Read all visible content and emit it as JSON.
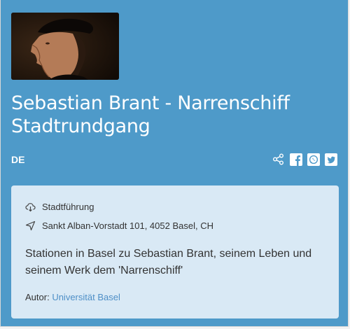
{
  "tour": {
    "title": "Sebastian Brant - Narrenschiff Stadtrundgang",
    "language": "DE"
  },
  "share": {
    "icons": [
      "share-icon",
      "facebook-icon",
      "whatsapp-icon",
      "twitter-icon"
    ]
  },
  "info": {
    "category": "Stadtführung",
    "address": "Sankt Alban-Vorstadt 101, 4052 Basel, CH",
    "description": "Stationen in Basel zu Sebastian Brant, seinem Leben und seinem Werk dem 'Narrenschiff'",
    "author_label": "Autor:",
    "author_name": "Universität Basel"
  },
  "colors": {
    "header_bg": "#4e9ac9",
    "info_bg": "#d9e9f5",
    "link": "#4e8fc7"
  }
}
